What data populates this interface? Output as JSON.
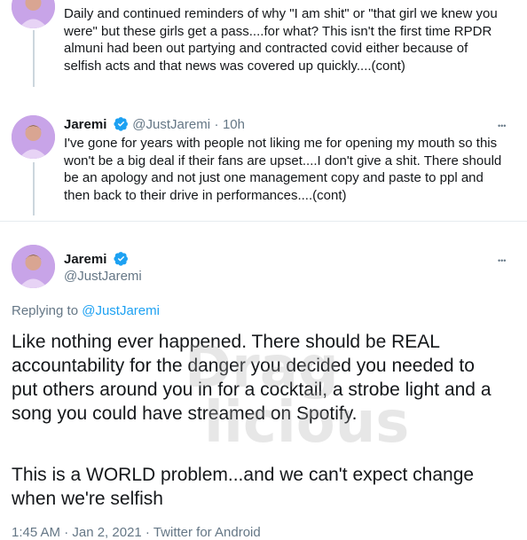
{
  "tweet1": {
    "lines": [
      "Daily and continued reminders of why \"I am shit\" or \"that girl we knew you",
      "were\" but these girls get a pass....for what? This isn't the first time RPDR",
      "almuni had been out partying and contracted covid either because of",
      "selfish acts and that news was covered up quickly....(cont)"
    ]
  },
  "tweet2": {
    "name": "Jaremi",
    "handle": "@JustJaremi",
    "separator": "·",
    "time": "10h",
    "more": "•••",
    "lines": [
      "I've gone for years with people not liking me for opening my mouth so this",
      "won't be a big deal if their fans are upset....I don't give a shit. There should",
      "be an apology and not just one management copy and paste to ppl and",
      "then back to their drive in performances....(cont)"
    ]
  },
  "tweet3": {
    "name": "Jaremi",
    "handle": "@JustJaremi",
    "more": "•••",
    "replying_prefix": "Replying to ",
    "replying_handle": "@JustJaremi",
    "lines": [
      "Like nothing ever happened. There should be REAL",
      "accountability for the danger you decided you needed to",
      "put others around you in for a cocktail, a strobe light and a",
      "song you could have streamed on Spotify."
    ],
    "lines2": [
      "This is a WORLD problem...and we can't expect change",
      "when we're selfish"
    ],
    "footer_partial": "1:45 AM · Jan 2, 2021 · Twitter for Android"
  },
  "watermark": {
    "line1": "Drag",
    "line2": "licious"
  },
  "colors": {
    "link": "#1da1f2",
    "verified": "#1da1f2",
    "muted": "#657786",
    "text": "#14171a"
  }
}
